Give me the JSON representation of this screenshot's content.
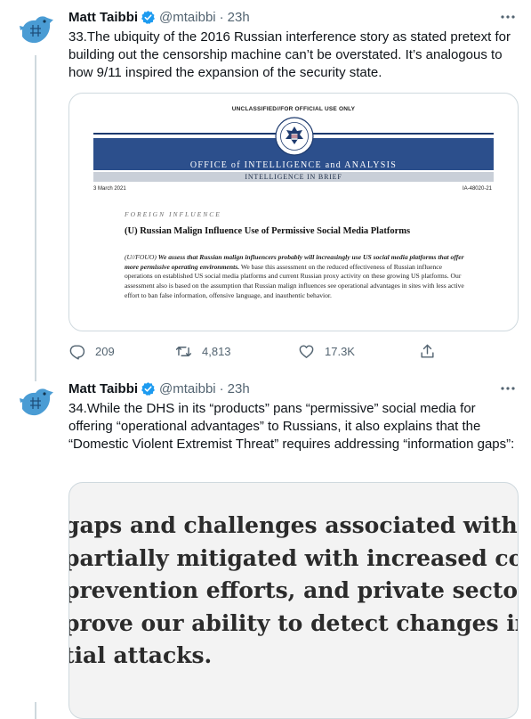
{
  "tweets": [
    {
      "author": {
        "name": "Matt Taibbi",
        "handle": "@mtaibbi",
        "time": "23h"
      },
      "text": "33.The ubiquity of the 2016 Russian interference story as stated pretext for building out the censorship machine can’t be overstated. It’s analogous to how 9/11 inspired the expansion of the security state.",
      "document": {
        "classification": "UNCLASSIFIED//FOR OFFICIAL USE ONLY",
        "office": "OFFICE of INTELLIGENCE and ANALYSIS",
        "subtitle": "INTELLIGENCE IN BRIEF",
        "date": "3 March 2021",
        "doc_id": "IA-48020-21",
        "section": "FOREIGN INFLUENCE",
        "heading": "(U) Russian Malign Influence Use of Permissive Social Media Platforms",
        "body_marking": "(U//FOUO)",
        "body_italic": "We assess that Russian malign influencers probably will increasingly use US social media platforms that offer more permissive operating environments.",
        "body_rest": "We base this assessment on the reduced effectiveness of Russian influence operations on established US social media platforms and current Russian proxy activity on these growing US platforms. Our assessment also is based on the assumption that Russian malign influences see operational advantages in sites with less active effort to ban false information, offensive language, and inauthentic behavior."
      },
      "stats": {
        "replies": "209",
        "retweets": "4,813",
        "likes": "17.3K"
      }
    },
    {
      "author": {
        "name": "Matt Taibbi",
        "handle": "@mtaibbi",
        "time": "23h"
      },
      "text": "34.While the DHS in its “products” pans “permissive” social media for offering “operational advantages” to Russians, it also explains that the “Domestic Violent Extremist Threat” requires addressing “information gaps”:",
      "zoom_lines": [
        "gaps and challenges associated with the i",
        "partially mitigated with increased collab",
        "prevention efforts, and private sector pa",
        "prove our ability to detect changes in DV",
        "tial attacks."
      ]
    }
  ],
  "colors": {
    "verified": "#1d9bf0",
    "muted": "#536471",
    "border": "#cfd9de"
  },
  "icons": [
    "bird-avatar-icon",
    "verified-badge-icon",
    "more-icon",
    "reply-icon",
    "retweet-icon",
    "like-icon",
    "share-icon"
  ]
}
